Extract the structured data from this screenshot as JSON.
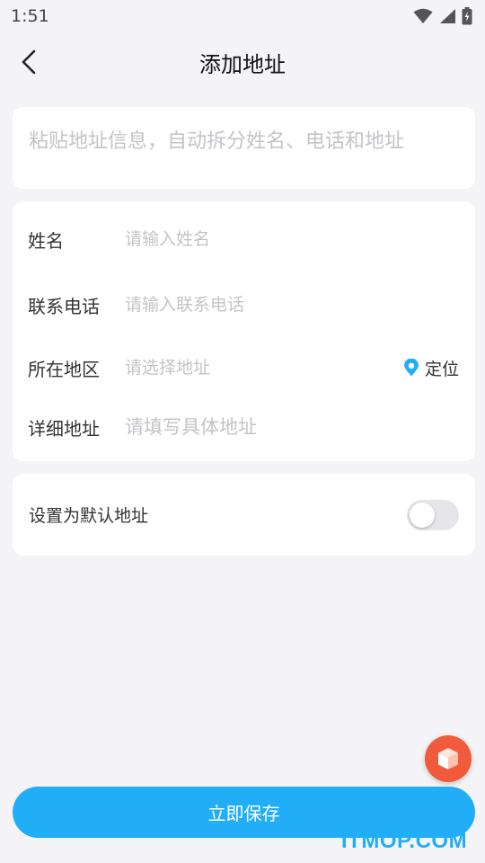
{
  "status_bar": {
    "time": "1:51"
  },
  "header": {
    "title": "添加地址"
  },
  "paste": {
    "placeholder": "粘贴地址信息，自动拆分姓名、电话和地址"
  },
  "form": {
    "name": {
      "label": "姓名",
      "placeholder": "请输入姓名"
    },
    "phone": {
      "label": "联系电话",
      "placeholder": "请输入联系电话"
    },
    "region": {
      "label": "所在地区",
      "placeholder": "请选择地址",
      "locate_label": "定位"
    },
    "detail": {
      "label": "详细地址",
      "placeholder": "请填写具体地址"
    }
  },
  "default_address": {
    "label": "设置为默认地址",
    "enabled": false
  },
  "footer": {
    "save_label": "立即保存"
  },
  "watermark": "ITMOP.COM",
  "colors": {
    "accent": "#22aef7",
    "float_button": "#f15a3a",
    "background": "#f4f4f6"
  },
  "icons": {
    "back": "chevron-left-icon",
    "locate": "location-pin-icon",
    "float": "cube-icon"
  }
}
